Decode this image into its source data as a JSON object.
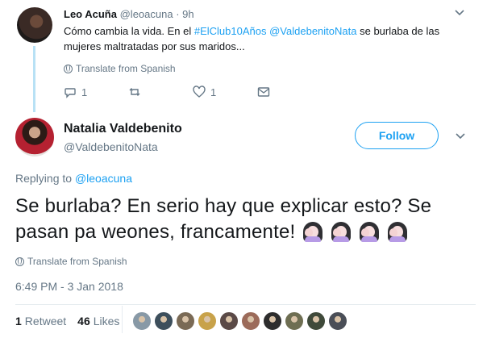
{
  "parent_tweet": {
    "name": "Leo Acuña",
    "handle": "@leoacuna",
    "separator": "·",
    "time": "9h",
    "text_before": "Cómo cambia la vida. En el ",
    "hashtag": "#ElClub10Años",
    "mention": "@ValdebenitoNata",
    "text_after": " se burlaba de las mujeres maltratadas por sus maridos...",
    "translate": "Translate from Spanish",
    "reply_count": "1",
    "retweet_count": "",
    "like_count": "1"
  },
  "main_tweet": {
    "name": "Natalia Valdebenito",
    "handle": "@ValdebenitoNata",
    "follow_label": "Follow",
    "replying_prefix": "Replying to ",
    "replying_to": "@leoacuna",
    "text": "Se burlaba? En serio hay que explicar esto? Se pasan pa weones, francamente!",
    "emoji_count": 4,
    "translate": "Translate from Spanish",
    "timestamp": "6:49 PM - 3 Jan 2018",
    "retweets_count": "1",
    "retweets_label": "Retweet",
    "likes_count": "46",
    "likes_label": "Likes"
  },
  "icons": {
    "reply": "reply-icon",
    "retweet": "retweet-icon",
    "like": "heart-icon",
    "dm": "envelope-icon",
    "caret": "chevron-down-icon",
    "translate": "globe-icon",
    "emoji": "face-palm-woman-emoji"
  },
  "colors": {
    "accent": "#1da1f2",
    "muted": "#657786",
    "text": "#14171a",
    "thread_line": "#b8e1f5"
  },
  "liker_avatar_colors": [
    "#8899a6",
    "#3d4f5c",
    "#7a6a55",
    "#c8a24a",
    "#5b4a47",
    "#9c6b5a",
    "#2d2d2d",
    "#6e6e52",
    "#3f4a3a",
    "#4a4e57"
  ]
}
